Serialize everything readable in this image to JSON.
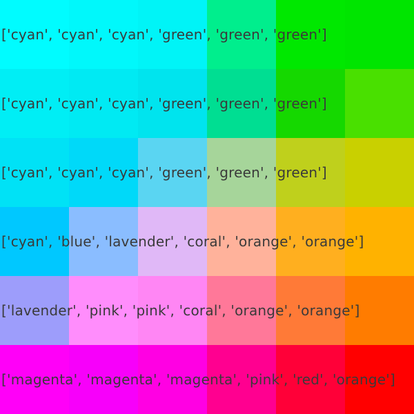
{
  "grid": {
    "rows": [
      {
        "label": "['cyan', 'cyan', 'cyan', 'green', 'green', 'green']",
        "colors": [
          "#00fcff",
          "#00f8fb",
          "#00f4f7",
          "#00ee8d",
          "#00e800",
          "#00e500"
        ]
      },
      {
        "label": "['cyan', 'cyan', 'cyan', 'green', 'green', 'green']",
        "colors": [
          "#00eef5",
          "#00eaf3",
          "#00e4ee",
          "#00de92",
          "#15d800",
          "#49e000"
        ]
      },
      {
        "label": "['cyan', 'cyan', 'cyan', 'green', 'green', 'green']",
        "colors": [
          "#00e2f6",
          "#00d9f9",
          "#5ad5f2",
          "#a6d59a",
          "#bfd01c",
          "#c9d000"
        ]
      },
      {
        "label": "['cyan', 'blue', 'lavender', 'coral', 'orange', 'orange']",
        "colors": [
          "#00c8ff",
          "#8abdff",
          "#e0b8f7",
          "#ffb29b",
          "#ffaf1f",
          "#ffb200"
        ]
      },
      {
        "label": "['lavender', 'pink', 'pink', 'coral', 'orange', 'orange']",
        "colors": [
          "#9d9dfb",
          "#ff8dfc",
          "#ff86f4",
          "#ff7899",
          "#ff7a37",
          "#ff7c00"
        ]
      },
      {
        "label": "['magenta', 'magenta', 'magenta', 'pink', 'red', 'orange']",
        "colors": [
          "#ff00f8",
          "#f700fa",
          "#ff00e3",
          "#ff0090",
          "#ff0038",
          "#ff0000"
        ]
      }
    ]
  }
}
